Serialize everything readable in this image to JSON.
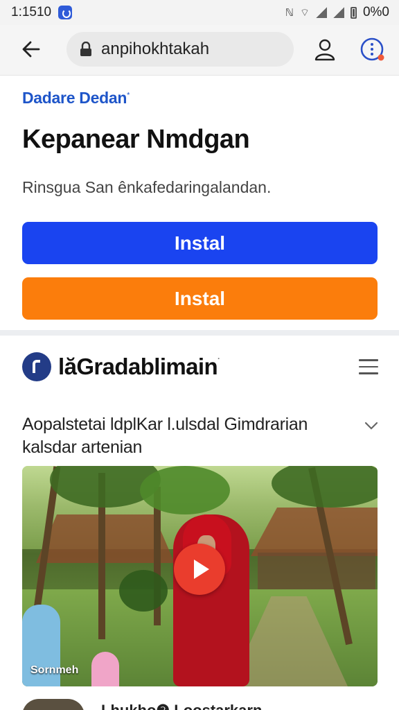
{
  "status_bar": {
    "time": "1:1510",
    "right_text": "0%0",
    "icons": [
      "messenger-icon",
      "nfc-icon",
      "wifi-icon",
      "signal-icon",
      "battery-icon"
    ]
  },
  "browser": {
    "url": "anpihokhtakah",
    "icons": [
      "back-arrow-icon",
      "lock-icon",
      "account-icon",
      "menu-dots-icon"
    ],
    "notification_dot_color": "#f05a3a"
  },
  "ad_card": {
    "brand": "Dadare Dedan",
    "brand_mark": "*",
    "headline": "Kepanear Nmdgan",
    "subtext": "Rinsgua San ênkafedaringalandan.",
    "primary_button": "Instal",
    "secondary_button": "Instal",
    "colors": {
      "brand": "#1e55c9",
      "primary": "#1a44f0",
      "secondary": "#fb7d0c"
    }
  },
  "site": {
    "name": "lăGradablimain",
    "name_mark": "·",
    "logo_color": "#233c87"
  },
  "article": {
    "title": "Aopalstetai ldplKar l.ulsdal Gimdrarian kalsdar artenian",
    "video_label": "Sornmeh",
    "play_color": "#ea3d2d"
  },
  "next_item": {
    "text": "Lhukho❷ Loostarkarn"
  }
}
